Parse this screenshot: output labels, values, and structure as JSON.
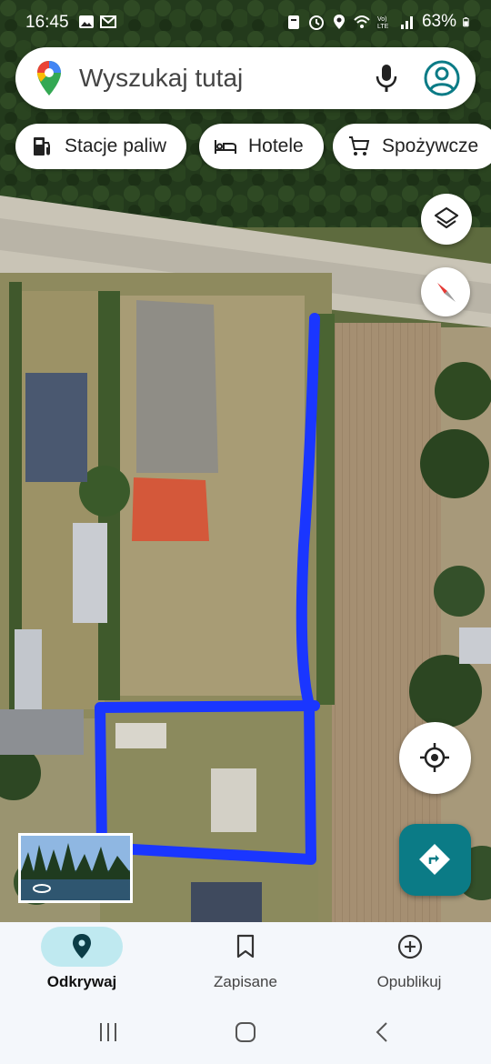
{
  "status_bar": {
    "time": "16:45",
    "battery": "63%",
    "left_icons": [
      "image-icon",
      "gmail-icon"
    ],
    "right_icons": [
      "clipboard-icon",
      "alarm-icon",
      "location-icon",
      "wifi-icon",
      "volte-icon",
      "signal-icon",
      "battery-icon"
    ]
  },
  "search": {
    "placeholder": "Wyszukaj tutaj",
    "icons": [
      "maps-pin-icon",
      "microphone-icon",
      "account-icon"
    ]
  },
  "chips": [
    {
      "label": "Stacje paliw",
      "icon": "gas-station-icon"
    },
    {
      "label": "Hotele",
      "icon": "bed-icon"
    },
    {
      "label": "Spożywcze",
      "icon": "cart-icon"
    }
  ],
  "map": {
    "drawn_line_color": "#1a36ff",
    "controls": [
      "layers-icon",
      "compass-icon",
      "my-location-icon",
      "directions-icon"
    ]
  },
  "bottom_nav": {
    "items": [
      {
        "label": "Odkrywaj",
        "icon": "pin-icon",
        "active": true
      },
      {
        "label": "Zapisane",
        "icon": "bookmark-icon",
        "active": false
      },
      {
        "label": "Opublikuj",
        "icon": "add-circle-icon",
        "active": false
      }
    ],
    "accent": "#bfe9f0"
  },
  "system_nav": [
    "recents-icon",
    "home-icon",
    "back-icon"
  ]
}
